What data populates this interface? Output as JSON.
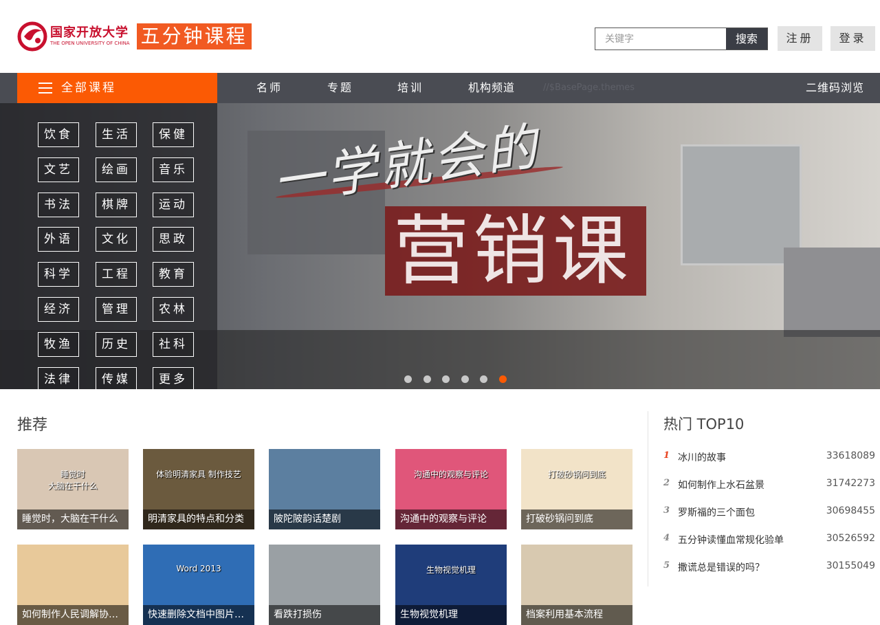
{
  "header": {
    "logo_cn": "国家开放大学",
    "logo_en": "THE OPEN UNIVERSITY OF CHINA",
    "logo_course": "五分钟课程",
    "search_placeholder": "关键字",
    "search_button": "搜索",
    "register": "注册",
    "login": "登录"
  },
  "nav": {
    "all_courses": "全部课程",
    "items": [
      "名师",
      "专题",
      "培训",
      "机构频道"
    ],
    "ghost_text": "//$BasePage.themes",
    "qr": "二维码浏览"
  },
  "banner": {
    "slogan": "一学就会的",
    "title": "营销课",
    "active_slide": 6,
    "slide_count": 6
  },
  "categories": [
    "饮食",
    "生活",
    "保健",
    "文艺",
    "绘画",
    "音乐",
    "书法",
    "棋牌",
    "运动",
    "外语",
    "文化",
    "思政",
    "科学",
    "工程",
    "教育",
    "经济",
    "管理",
    "农林",
    "牧渔",
    "历史",
    "社科",
    "法律",
    "传媒",
    "更多"
  ],
  "recommend": {
    "title": "推荐",
    "cards": [
      {
        "caption": "睡觉时，大脑在干什么",
        "thumb_text": "睡觉时\n大脑在干什么",
        "color": "#d9c7b4"
      },
      {
        "caption": "明清家具的特点和分类",
        "thumb_text": "体验明清家具 制作技艺",
        "color": "#6b5a3e"
      },
      {
        "caption": "陂陀陂韵话楚剧",
        "thumb_text": "",
        "color": "#5c7fa0"
      },
      {
        "caption": "沟通中的观察与评论",
        "thumb_text": "沟通中的观察与评论",
        "color": "#e0567a"
      },
      {
        "caption": "打破砂锅问到底",
        "thumb_text": "打破砂锅问到底",
        "color": "#f2e3c8"
      },
      {
        "caption": "如何制作人民调解协议书",
        "thumb_text": "",
        "color": "#e8c99a"
      },
      {
        "caption": "快速删除文档中图片的背景",
        "thumb_text": "Word 2013",
        "color": "#2f6db5"
      },
      {
        "caption": "看跌打损伤",
        "thumb_text": "",
        "color": "#9aa0a4"
      },
      {
        "caption": "生物视觉机理",
        "thumb_text": "生物视觉机理",
        "color": "#1f3d7a"
      },
      {
        "caption": "档案利用基本流程",
        "thumb_text": "",
        "color": "#d8c9b0"
      }
    ]
  },
  "top10": {
    "title": "热门 TOP10",
    "items": [
      {
        "rank": "1",
        "name": "冰川的故事",
        "count": "33618089"
      },
      {
        "rank": "2",
        "name": "如何制作上水石盆景",
        "count": "31742273"
      },
      {
        "rank": "3",
        "name": "罗斯福的三个面包",
        "count": "30698455"
      },
      {
        "rank": "4",
        "name": "五分钟读懂血常规化验单",
        "count": "30526592"
      },
      {
        "rank": "5",
        "name": "撒谎总是错误的吗？",
        "count": "30155049"
      }
    ]
  },
  "colors": {
    "accent": "#fb5a04",
    "nav_bg": "#4a4c53",
    "logo_red": "#c8102e"
  }
}
